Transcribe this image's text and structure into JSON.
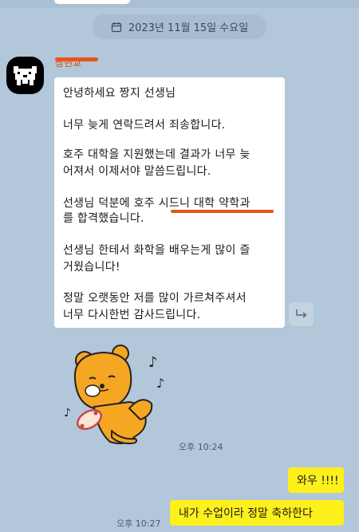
{
  "chat": {
    "date_label": "2023년 11월 15일 수요일",
    "sender_name": "장현교",
    "message_lines": [
      "안녕하세요  짱지 선생님",
      "",
      "너무 늦게 연락드려서 죄송합니다.",
      "",
      "호주 대학을 지원했는데 결과가 너무 늦",
      "어져서 이제서야 말씀드립니다.",
      "",
      "선생님 덕분에 호주 시드니 대학 약학과",
      "를 합격했습니다.",
      "",
      "선생님 한테서 화학을 배우는게 많이 즐",
      "거웠습니다!",
      "",
      "정말 오랫동안 저를 많이 가르쳐주셔서",
      "너무 다시한번 감사드립니다."
    ],
    "sticker_time": "오후 10:24",
    "outgoing": [
      {
        "text": "와우 !!!!"
      },
      {
        "text": "내가 수업이라 정말 축하한다"
      }
    ],
    "outgoing_time": "오후 10:27"
  },
  "icons": {
    "date": "calendar-icon",
    "share": "share-arrow-icon",
    "sticker": "ryan-bear-sticker"
  },
  "colors": {
    "background": "#b2c7d9",
    "incoming_bubble": "#ffffff",
    "outgoing_bubble": "#fef01b",
    "annotation": "#e8541a"
  }
}
